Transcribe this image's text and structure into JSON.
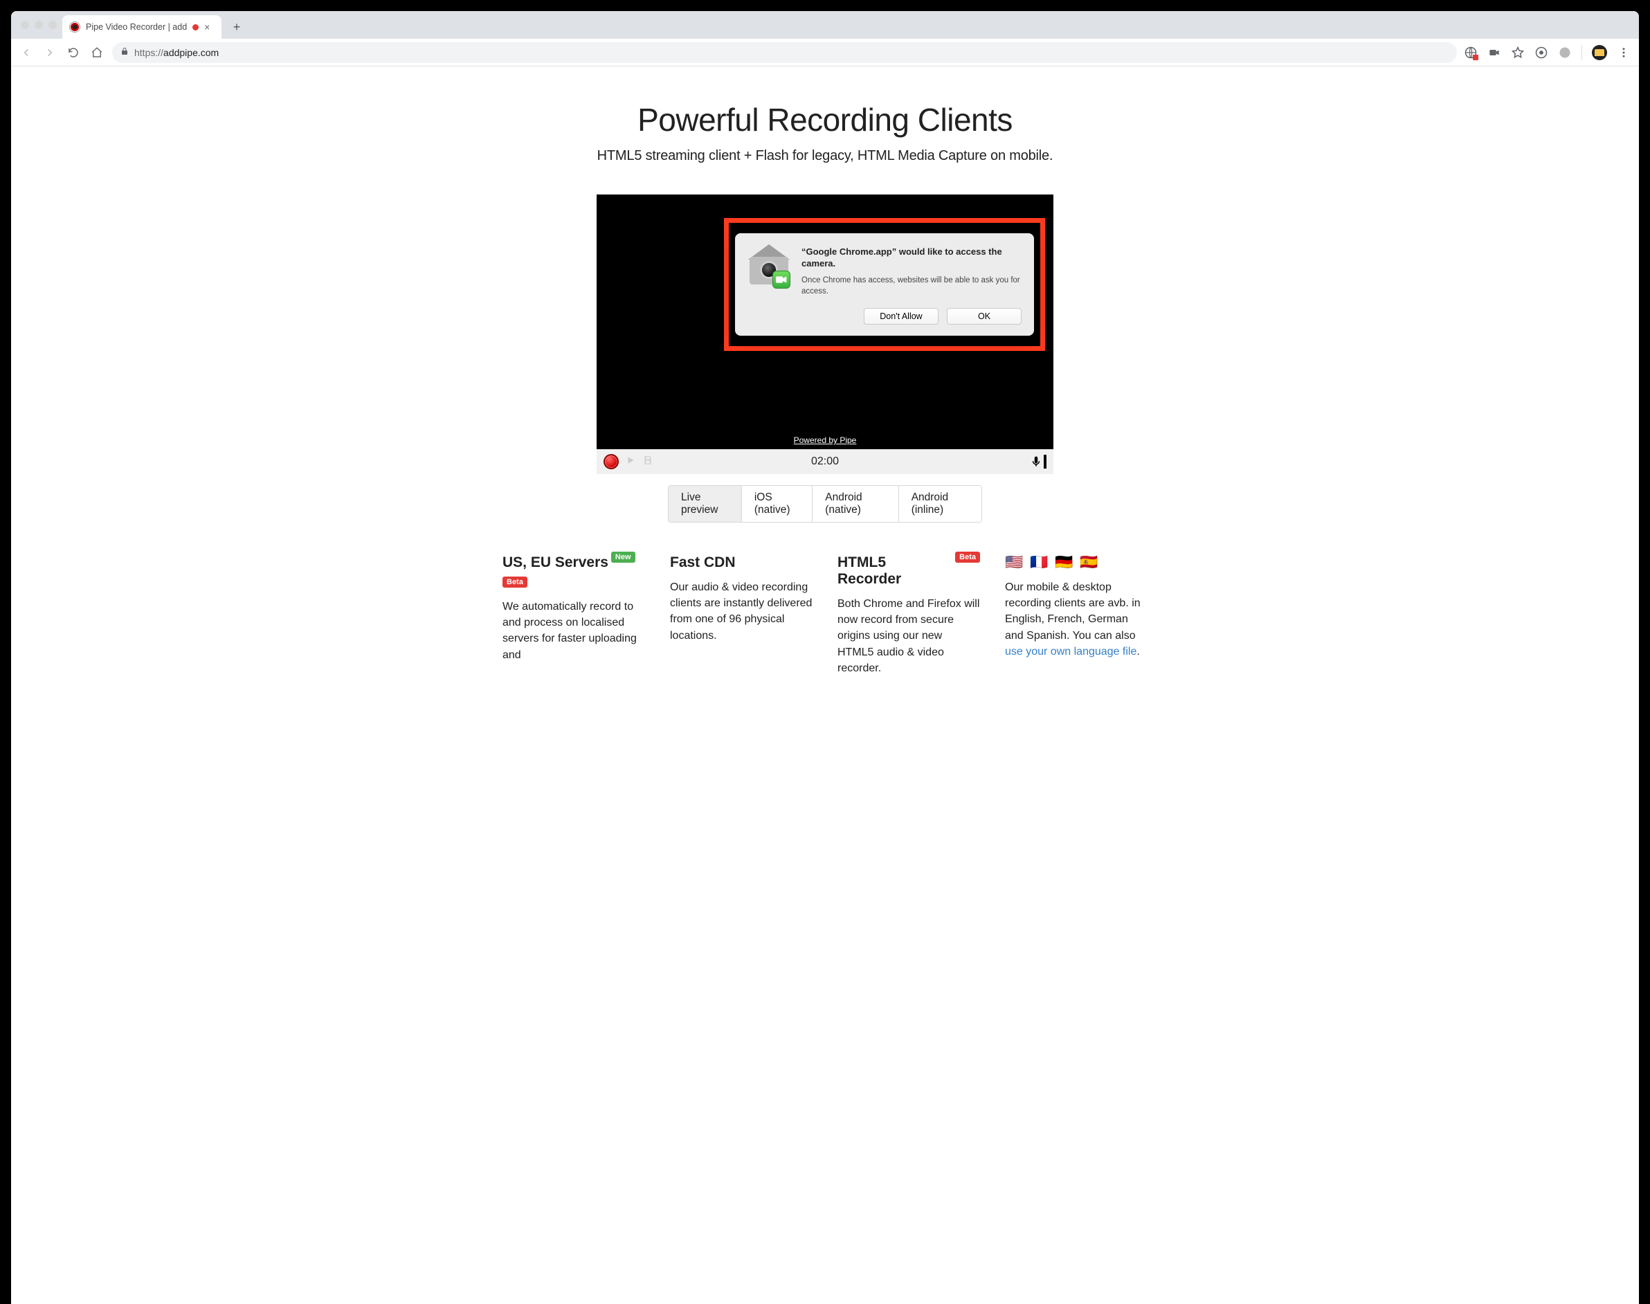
{
  "window": {
    "tab_title": "Pipe Video Recorder | add",
    "url_display": "https://addpipe.com",
    "url_protocol": "https://",
    "url_host": "addpipe.com"
  },
  "hero": {
    "title": "Powerful Recording Clients",
    "subtitle": "HTML5 streaming client + Flash for legacy, HTML Media Capture on mobile."
  },
  "recorder": {
    "powered_by": "Powered by Pipe",
    "time_display": "02:00"
  },
  "permission_dialog": {
    "title": "“Google Chrome.app” would like to access the camera.",
    "description": "Once Chrome has access, websites will be able to ask you for access.",
    "deny_label": "Don't Allow",
    "allow_label": "OK"
  },
  "preview_tabs": {
    "items": [
      {
        "label": "Live preview",
        "active": true
      },
      {
        "label": "iOS (native)",
        "active": false
      },
      {
        "label": "Android (native)",
        "active": false
      },
      {
        "label": "Android (inline)",
        "active": false
      }
    ]
  },
  "features": [
    {
      "title": "US, EU Servers",
      "badge_top": "New",
      "badge_below": "Beta",
      "body": "We automatically record to and process on localised servers for faster uploading and"
    },
    {
      "title": "Fast CDN",
      "body": "Our audio & video recording clients are instantly delivered from one of 96 physical locations."
    },
    {
      "title": "HTML5 Recorder",
      "badge_top": "Beta",
      "body": "Both Chrome and Firefox will now record from secure origins using our new HTML5 audio & video recorder."
    },
    {
      "flags": "🇺🇸 🇫🇷 🇩🇪 🇪🇸",
      "body": "Our mobile & desktop recording clients are avb. in English, French, German and Spanish. You can also ",
      "link_text": "use your own language file"
    }
  ]
}
